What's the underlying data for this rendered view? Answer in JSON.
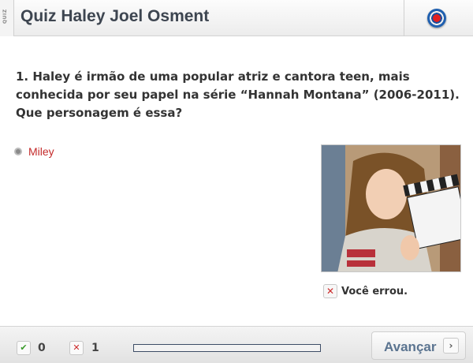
{
  "header": {
    "tab_label": "QUIZ",
    "title": "Quiz Haley Joel Osment",
    "logo_icon": "globo-logo-icon"
  },
  "question": {
    "text": "1. Haley é irmão de uma popular atriz e cantora teen, mais conhecida por seu papel  na série  “Hannah Montana” (2006-2011).  Que personagem é essa?"
  },
  "options": [
    {
      "label": "Miley",
      "color": "#c42a2a"
    }
  ],
  "feedback": {
    "icon": "x-icon",
    "text": "Você errou."
  },
  "footer": {
    "correct_icon": "check-icon",
    "correct_count": "0",
    "wrong_icon": "x-icon",
    "wrong_count": "1",
    "progress": 0,
    "next_label": "Avançar",
    "next_icon": "chevron-right-icon"
  },
  "colors": {
    "title": "#3d4550",
    "answer_wrong": "#c42a2a",
    "progress_border": "#3d4d66",
    "next_label": "#5b7490"
  }
}
